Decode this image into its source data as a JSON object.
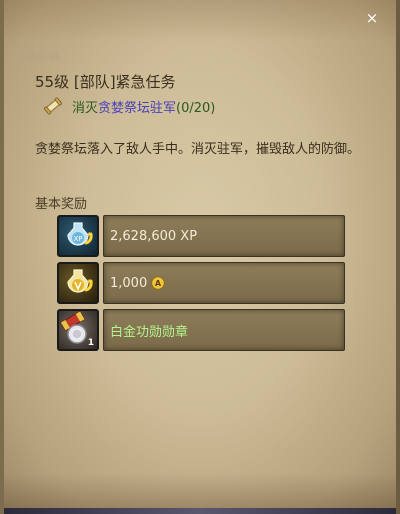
{
  "window": {
    "close_glyph": "×",
    "header_label": "任务说明"
  },
  "mission": {
    "title": "55级 [部队]紧急任务",
    "objective_prefix": "消灭",
    "objective_target": "贪婪祭坛驻军",
    "objective_progress": "(0/20)",
    "objective_icon": "scroll-icon",
    "description": "贪婪祭坛落入了敌人手中。消灭驻军，摧毁敌人的防御。"
  },
  "rewards": {
    "section_title": "基本奖励",
    "items": [
      {
        "icon": "xp-potion-icon",
        "text": "2,628,600 XP"
      },
      {
        "icon": "gold-potion-icon",
        "text": "1,000",
        "currency_icon": "coin-icon",
        "currency_glyph": "A"
      },
      {
        "icon": "medal-icon",
        "text": "白金功勋勋章",
        "quantity": "1"
      }
    ]
  },
  "colors": {
    "parchment": "#cdbc97",
    "objective_green": "#2b5a1e",
    "objective_link": "#4b3fb7",
    "reward_item_green": "#b6f58f"
  }
}
